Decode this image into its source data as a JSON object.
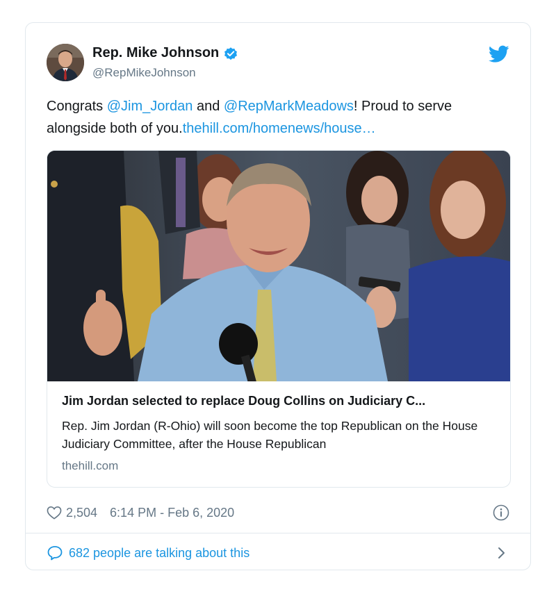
{
  "author": {
    "name": "Rep. Mike Johnson",
    "handle": "@RepMikeJohnson",
    "verified_icon": "verified-badge-icon"
  },
  "tweet": {
    "text_parts": [
      {
        "text": "Congrats ",
        "link": false
      },
      {
        "text": "@Jim_Jordan",
        "link": true
      },
      {
        "text": " and ",
        "link": false
      },
      {
        "text": "@RepMarkMeadows",
        "link": true
      },
      {
        "text": "! Proud to serve alongside both of you.",
        "link": false
      },
      {
        "text": "thehill.com/homenews/house…",
        "link": true
      }
    ]
  },
  "card": {
    "title": "Jim Jordan selected to replace Doug Collins on Judiciary C...",
    "description": "Rep. Jim Jordan (R-Ohio) will soon become the top Republican on the House Judiciary Committee, after the House Republican",
    "domain": "thehill.com"
  },
  "meta": {
    "likes": "2,504",
    "timestamp": "6:14 PM - Feb 6, 2020"
  },
  "footer": {
    "conversation_label": "682 people are talking about this"
  },
  "colors": {
    "link": "#1b95e0",
    "secondary_text": "#657786",
    "border": "#e1e8ed"
  }
}
